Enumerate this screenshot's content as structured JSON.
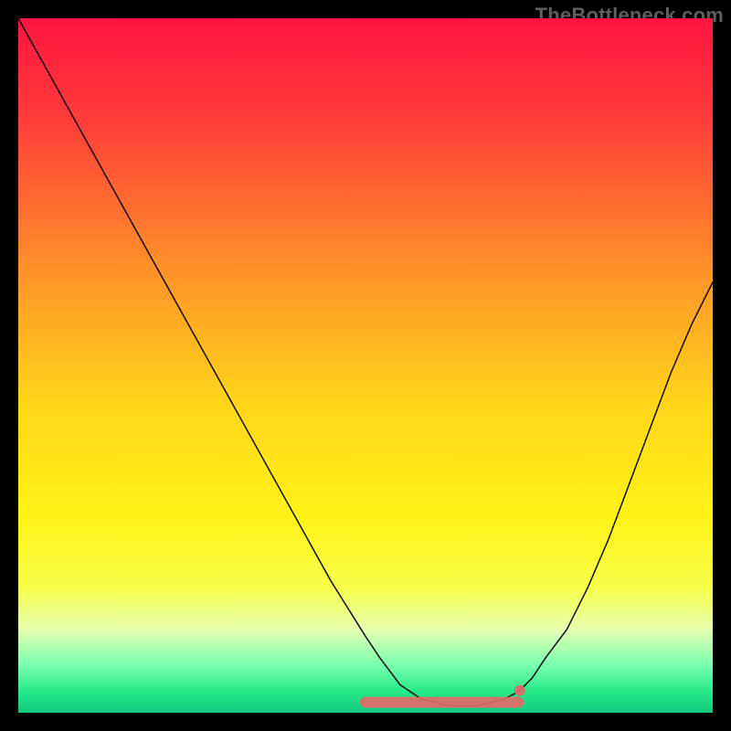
{
  "watermark": "TheBottleneck.com",
  "chart_data": {
    "type": "line",
    "title": "",
    "xlabel": "",
    "ylabel": "",
    "xlim": [
      0,
      100
    ],
    "ylim": [
      0,
      100
    ],
    "grid": false,
    "axes_visible": false,
    "background": {
      "type": "vertical-gradient",
      "stops": [
        {
          "pos": 0.0,
          "color": "#ff1440"
        },
        {
          "pos": 0.15,
          "color": "#ff3e3a"
        },
        {
          "pos": 0.35,
          "color": "#ff8d2b"
        },
        {
          "pos": 0.55,
          "color": "#ffd41a"
        },
        {
          "pos": 0.72,
          "color": "#fff317"
        },
        {
          "pos": 0.82,
          "color": "#f7ff4a"
        },
        {
          "pos": 0.88,
          "color": "#e6ffb0"
        },
        {
          "pos": 0.93,
          "color": "#7cffb0"
        },
        {
          "pos": 0.97,
          "color": "#25e989"
        },
        {
          "pos": 1.0,
          "color": "#12c97b"
        }
      ]
    },
    "series": [
      {
        "name": "bottleneck-curve",
        "color": "#000000",
        "width": 1.4,
        "x": [
          0,
          5,
          10,
          15,
          20,
          25,
          30,
          35,
          40,
          45,
          50,
          52,
          55,
          58,
          62,
          66,
          70,
          72,
          74,
          76,
          79,
          82,
          85,
          88,
          91,
          94,
          97,
          100
        ],
        "y": [
          100,
          91,
          82,
          73,
          64,
          55,
          46,
          37,
          28,
          19,
          11,
          8,
          4,
          2,
          1,
          1,
          2,
          3,
          5,
          8,
          12,
          18,
          25,
          33,
          41,
          49,
          56,
          62
        ]
      }
    ],
    "flat_band": {
      "name": "optimum-band",
      "color": "#e26a6a",
      "width": 12,
      "x_start": 50,
      "x_end": 72,
      "y": 1.5,
      "end_dot": {
        "x": 72.2,
        "y": 3.2,
        "r": 6
      }
    }
  }
}
